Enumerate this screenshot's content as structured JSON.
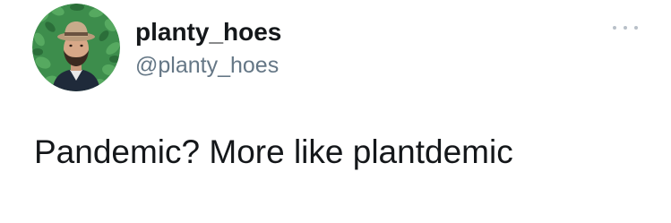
{
  "tweet": {
    "author": {
      "display_name": "planty_hoes",
      "handle": "@planty_hoes",
      "avatar_icon": "profile-photo-man-with-hat-on-ivy-background"
    },
    "more_icon": "more-options-icon",
    "text": "Pandemic? More like plantdemic"
  },
  "colors": {
    "text": "#14171a",
    "secondary_text": "#657786",
    "more_dots": "#b8c0c8",
    "avatar_foliage": "#3a8a4a"
  }
}
